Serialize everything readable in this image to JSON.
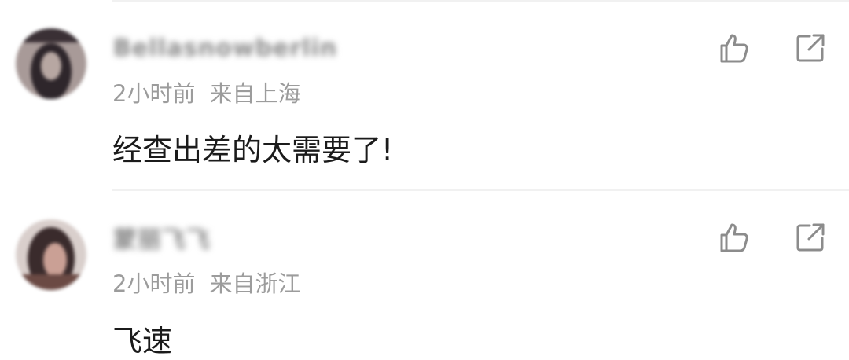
{
  "comments": [
    {
      "username": "Bellasnowberlin",
      "time": "2小时前",
      "location": "来自上海",
      "content": "经查出差的太需要了!",
      "avatar_colors": [
        "#3a2f35",
        "#b8aaa8",
        "#1f1b20"
      ]
    },
    {
      "username": "蒙丽飞飞",
      "time": "2小时前",
      "location": "来自浙江",
      "content": "飞速",
      "avatar_colors": [
        "#2e2528",
        "#c89a8a",
        "#5a3a34"
      ]
    }
  ],
  "icons": {
    "like": "thumbs-up-icon",
    "share": "share-external-icon"
  },
  "colors": {
    "meta_text": "#9c9c9c",
    "content_text": "#1b1b1b",
    "icon_stroke": "#8c8c8c",
    "divider": "#f1f1f1"
  }
}
